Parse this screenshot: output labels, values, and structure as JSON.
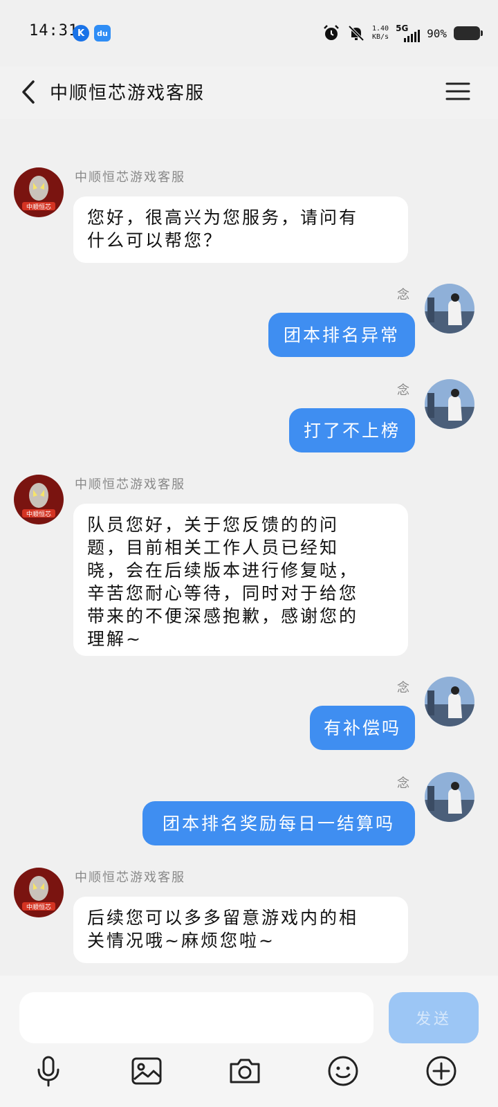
{
  "status_bar": {
    "time": "14:31",
    "app_badges": [
      "K",
      "du"
    ],
    "net_speed_value": "1.40",
    "net_speed_unit": "KB/s",
    "network": "5G",
    "battery": "90%"
  },
  "nav": {
    "title": "中顺恒芯游戏客服"
  },
  "messages": [
    {
      "side": "in",
      "sender": "中顺恒芯游戏客服",
      "lines": [
        "您好，很高兴为您服务，请问有",
        "什么可以帮您？"
      ]
    },
    {
      "side": "out",
      "sender": "念",
      "text": "团本排名异常"
    },
    {
      "side": "out",
      "sender": "念",
      "text": "打了不上榜"
    },
    {
      "side": "in",
      "sender": "中顺恒芯游戏客服",
      "lines": [
        "队员您好，关于您反馈的的问",
        "题，目前相关工作人员已经知",
        "晓，会在后续版本进行修复哒，",
        "辛苦您耐心等待，同时对于给您",
        "带来的不便深感抱歉，感谢您的",
        "理解~"
      ]
    },
    {
      "side": "out",
      "sender": "念",
      "text": "有补偿吗"
    },
    {
      "side": "out",
      "sender": "念",
      "text": "团本排名奖励每日一结算吗"
    },
    {
      "side": "in",
      "sender": "中顺恒芯游戏客服",
      "lines": [
        "后续您可以多多留意游戏内的相",
        "关情况哦~麻烦您啦~"
      ]
    }
  ],
  "input": {
    "value": "",
    "send_label": "发送"
  },
  "toolbar_icons": [
    "microphone-icon",
    "image-icon",
    "camera-icon",
    "emoji-icon",
    "plus-icon"
  ],
  "colors": {
    "outgoing_bubble": "#3f8ef1",
    "incoming_bubble": "#ffffff",
    "send_button_disabled": "#9cc6f5",
    "background": "#f0f0f0"
  }
}
